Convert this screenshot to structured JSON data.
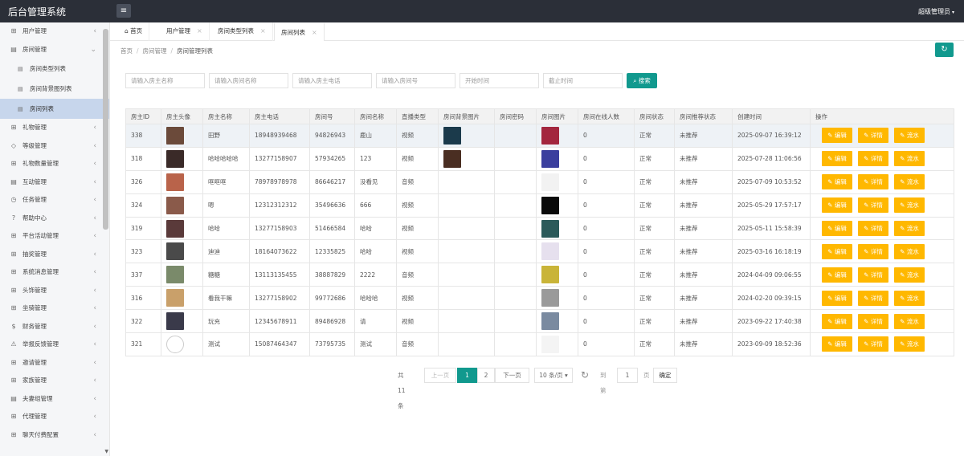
{
  "app": {
    "title": "后台管理系统",
    "user": "超级管理员"
  },
  "sidebar": {
    "items": [
      {
        "icon": "⊞",
        "label": "用户管理",
        "arrow": "‹"
      },
      {
        "icon": "▤",
        "label": "房间管理",
        "arrow": "⌄"
      },
      {
        "icon": "▤",
        "label": "房间类型列表",
        "sub": true
      },
      {
        "icon": "▤",
        "label": "房间背景图列表",
        "sub": true
      },
      {
        "icon": "▤",
        "label": "房间列表",
        "sub": true,
        "active": true
      },
      {
        "icon": "⊞",
        "label": "礼物管理",
        "arrow": "‹"
      },
      {
        "icon": "◇",
        "label": "等级管理",
        "arrow": "‹"
      },
      {
        "icon": "⊞",
        "label": "礼物数量管理",
        "arrow": "‹"
      },
      {
        "icon": "▤",
        "label": "互动管理",
        "arrow": "‹"
      },
      {
        "icon": "◷",
        "label": "任务管理",
        "arrow": "‹"
      },
      {
        "icon": "?",
        "label": "帮助中心",
        "arrow": "‹"
      },
      {
        "icon": "⊞",
        "label": "平台活动管理",
        "arrow": "‹"
      },
      {
        "icon": "⊞",
        "label": "抽奖管理",
        "arrow": "‹"
      },
      {
        "icon": "⊞",
        "label": "系统消息管理",
        "arrow": "‹"
      },
      {
        "icon": "⊞",
        "label": "头饰管理",
        "arrow": "‹"
      },
      {
        "icon": "⊞",
        "label": "坐骑管理",
        "arrow": "‹"
      },
      {
        "icon": "$",
        "label": "财务管理",
        "arrow": "‹"
      },
      {
        "icon": "⚠",
        "label": "举报反馈管理",
        "arrow": "‹"
      },
      {
        "icon": "⊞",
        "label": "邀请管理",
        "arrow": "‹"
      },
      {
        "icon": "⊞",
        "label": "家族管理",
        "arrow": "‹"
      },
      {
        "icon": "▤",
        "label": "夫妻组管理",
        "arrow": "‹"
      },
      {
        "icon": "⊞",
        "label": "代理管理",
        "arrow": "‹"
      },
      {
        "icon": "⊞",
        "label": "聊天付费配置",
        "arrow": "‹"
      }
    ]
  },
  "tabs": [
    {
      "label": "首页",
      "icon": "⌂",
      "closable": false
    },
    {
      "label": "用户管理",
      "closable": true
    },
    {
      "label": "房间类型列表",
      "closable": true
    },
    {
      "label": "房间列表",
      "closable": true,
      "active": true
    }
  ],
  "breadcrumb": [
    "首页",
    "房间管理",
    "房间管理列表"
  ],
  "search": {
    "placeholders": [
      "请输入房主名称",
      "请输入房间名称",
      "请输入房主电话",
      "请输入房间号",
      "开始时间",
      "截止时间"
    ],
    "button": "搜索"
  },
  "table": {
    "headers": [
      "房主ID",
      "房主头像",
      "房主名称",
      "房主电话",
      "房间号",
      "房间名称",
      "直播类型",
      "房间背景图片",
      "房间密码",
      "房间图片",
      "房间在线人数",
      "房间状态",
      "房间推荐状态",
      "创建时间",
      "操作"
    ],
    "rows": [
      {
        "id": "338",
        "name": "田野",
        "phone": "18948939468",
        "room": "94826943",
        "room_name": "鹿山",
        "type": "视频",
        "bg": "#1b3a4b",
        "pw": "",
        "pic": "#a3263e",
        "online": "0",
        "status": "正常",
        "rec": "未推荐",
        "created": "2025-09-07 16:39:12",
        "avatar": "#6b4a3a"
      },
      {
        "id": "318",
        "name": "哈哈哈哈哈",
        "phone": "13277158907",
        "room": "57934265",
        "room_name": "123",
        "type": "视频",
        "bg": "#4a2e22",
        "pw": "",
        "pic": "#3b3f9e",
        "online": "0",
        "status": "正常",
        "rec": "未推荐",
        "created": "2025-07-28 11:06:56",
        "avatar": "#3a2a28"
      },
      {
        "id": "326",
        "name": "哐哐哐",
        "phone": "78978978978",
        "room": "86646217",
        "room_name": "没看见",
        "type": "音频",
        "bg": "",
        "pw": "",
        "pic": "#f2f2f2",
        "online": "0",
        "status": "正常",
        "rec": "未推荐",
        "created": "2025-07-09 10:53:52",
        "avatar": "#b9634a"
      },
      {
        "id": "324",
        "name": "嗯",
        "phone": "12312312312",
        "room": "35496636",
        "room_name": "666",
        "type": "视频",
        "bg": "",
        "pw": "",
        "pic": "#0a0a0a",
        "online": "0",
        "status": "正常",
        "rec": "未推荐",
        "created": "2025-05-29 17:57:17",
        "avatar": "#8a5a4a"
      },
      {
        "id": "319",
        "name": "哈哈",
        "phone": "13277158903",
        "room": "51466584",
        "room_name": "哈哈",
        "type": "视频",
        "bg": "",
        "pw": "",
        "pic": "#2b5a5a",
        "online": "0",
        "status": "正常",
        "rec": "未推荐",
        "created": "2025-05-11 15:58:39",
        "avatar": "#5a3a3a"
      },
      {
        "id": "323",
        "name": "迪迪",
        "phone": "18164073622",
        "room": "12335825",
        "room_name": "哈哈",
        "type": "视频",
        "bg": "",
        "pw": "",
        "pic": "#e6e0ee",
        "online": "0",
        "status": "正常",
        "rec": "未推荐",
        "created": "2025-03-16 16:18:19",
        "avatar": "#4a4a4a"
      },
      {
        "id": "337",
        "name": "糖糖",
        "phone": "13113135455",
        "room": "38887829",
        "room_name": "2222",
        "type": "音频",
        "bg": "",
        "pw": "",
        "pic": "#c9b438",
        "online": "0",
        "status": "正常",
        "rec": "未推荐",
        "created": "2024-04-09 09:06:55",
        "avatar": "#7a8a6a"
      },
      {
        "id": "316",
        "name": "看我干嘛",
        "phone": "13277158902",
        "room": "99772686",
        "room_name": "哈哈哈",
        "type": "视频",
        "bg": "",
        "pw": "",
        "pic": "#9a9a9a",
        "online": "0",
        "status": "正常",
        "rec": "未推荐",
        "created": "2024-02-20 09:39:15",
        "avatar": "#c9a06a"
      },
      {
        "id": "322",
        "name": "玩充",
        "phone": "12345678911",
        "room": "89486928",
        "room_name": "请",
        "type": "视频",
        "bg": "",
        "pw": "",
        "pic": "#7a8aa0",
        "online": "0",
        "status": "正常",
        "rec": "未推荐",
        "created": "2023-09-22 17:40:38",
        "avatar": "#3a3a4a"
      },
      {
        "id": "321",
        "name": "测试",
        "phone": "15087464347",
        "room": "73795735",
        "room_name": "测试",
        "type": "音频",
        "bg": "",
        "pw": "",
        "pic": "#f4f4f4",
        "online": "0",
        "status": "正常",
        "rec": "未推荐",
        "created": "2023-09-09 18:52:36",
        "avatar": "#ffffff"
      }
    ],
    "actions": [
      "编辑",
      "详情",
      "流水"
    ]
  },
  "pager": {
    "total": "共 11 条",
    "prev": "上一页",
    "pages": [
      "1",
      "2"
    ],
    "next": "下一页",
    "size": "10 条/页",
    "goto": "到第",
    "page_val": "1",
    "page_unit": "页",
    "confirm": "确定"
  },
  "colors": {
    "accent": "#11998e",
    "warning": "#ffb800",
    "topbar": "#2b2f38"
  }
}
